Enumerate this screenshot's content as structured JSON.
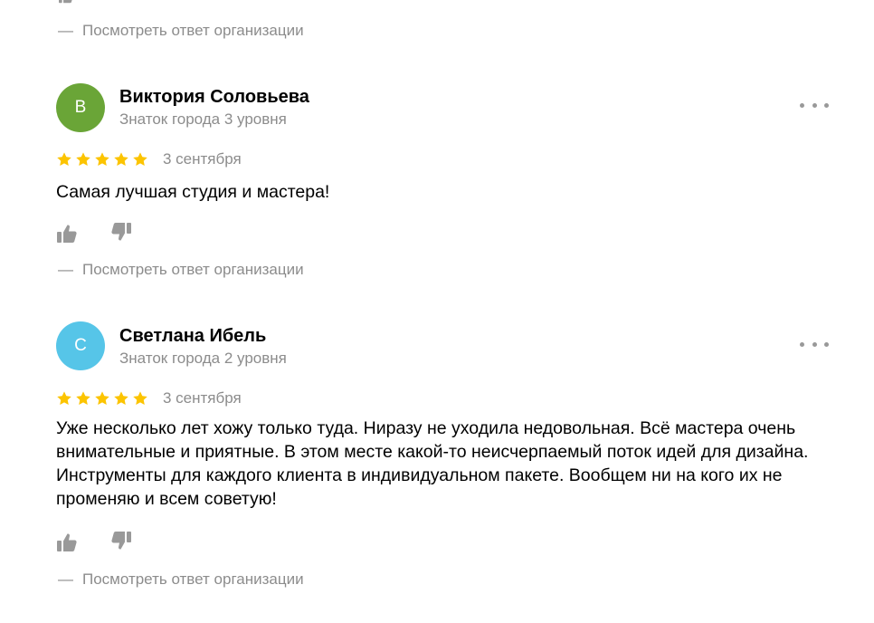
{
  "org_response_label": "Посмотреть ответ организации",
  "dash": "—",
  "icons": {
    "like": "thumbs-up-icon",
    "dislike": "thumbs-down-icon",
    "more": "more-dots-icon",
    "star": "star-icon"
  },
  "colors": {
    "star": "#fcc400",
    "muted_text": "#8c8c8c",
    "icon_gray": "#999999"
  },
  "reviews": [
    {
      "avatar_letter": "В",
      "avatar_color": "#6aa537",
      "author": "Виктория Соловьева",
      "level": "Знаток города 3 уровня",
      "rating": 5,
      "date": "3 сентября",
      "text": "Самая лучшая студия и мастера!"
    },
    {
      "avatar_letter": "С",
      "avatar_color": "#56c5e8",
      "author": "Светлана Ибель",
      "level": "Знаток города 2 уровня",
      "rating": 5,
      "date": "3 сентября",
      "text": "Уже несколько лет хожу только туда. Ниразу не уходила недовольная. Всё мастера очень внимательные и приятные. В этом месте какой-то неисчерпаемый поток идей для дизайна. Инструменты для каждого клиента в индивидуальном пакете. Вообщем ни на кого их не променяю и всем советую!"
    }
  ]
}
